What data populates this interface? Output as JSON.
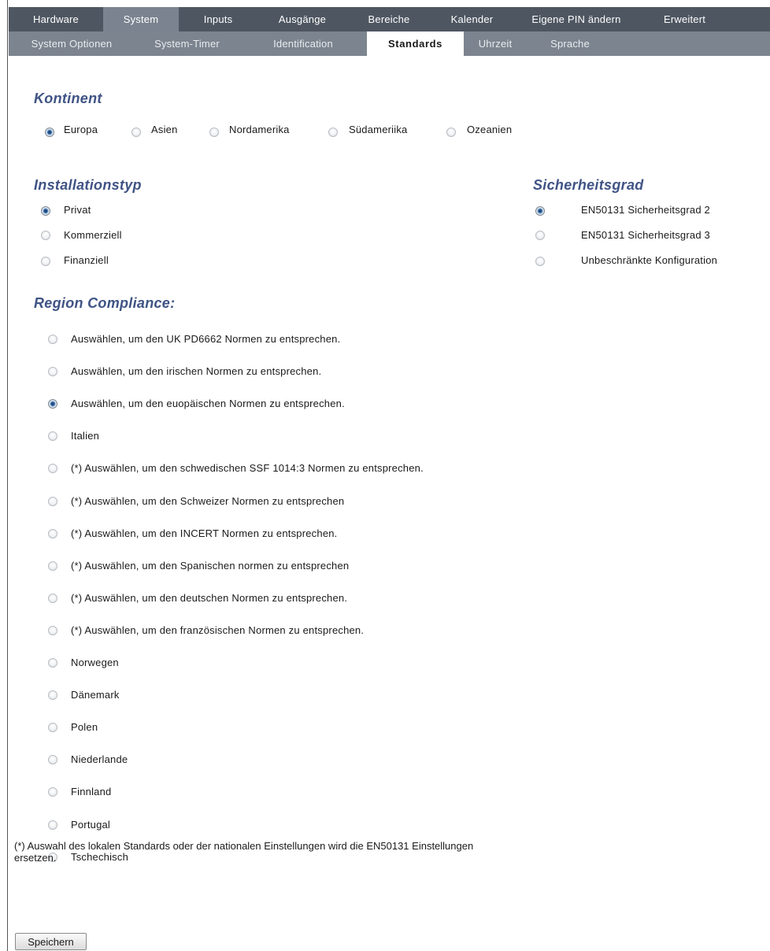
{
  "nav_primary": [
    {
      "label": "Hardware",
      "active": false
    },
    {
      "label": "System",
      "active": true
    },
    {
      "label": "Inputs",
      "active": false
    },
    {
      "label": "Ausgänge",
      "active": false
    },
    {
      "label": "Bereiche",
      "active": false
    },
    {
      "label": "Kalender",
      "active": false
    },
    {
      "label": "Eigene PIN ändern",
      "active": false
    },
    {
      "label": "Erweitert",
      "active": false
    }
  ],
  "nav_secondary": [
    {
      "label": "System Optionen",
      "active": false
    },
    {
      "label": "System-Timer",
      "active": false
    },
    {
      "label": "Identification",
      "active": false
    },
    {
      "label": "Standards",
      "active": true
    },
    {
      "label": "Uhrzeit",
      "active": false
    },
    {
      "label": "Sprache",
      "active": false
    }
  ],
  "kontinent": {
    "heading": "Kontinent",
    "selected": "Europa",
    "options": [
      "Europa",
      "Asien",
      "Nordamerika",
      "Südameriika",
      "Ozeanien"
    ]
  },
  "installationstyp": {
    "heading": "Installationstyp",
    "selected": "Privat",
    "options": [
      "Privat",
      "Kommerziell",
      "Finanziell"
    ]
  },
  "sicherheitsgrad": {
    "heading": "Sicherheitsgrad",
    "selected": "EN50131 Sicherheitsgrad 2",
    "options": [
      "EN50131 Sicherheitsgrad 2",
      "EN50131 Sicherheitsgrad 3",
      "Unbeschränkte Konfiguration"
    ]
  },
  "region": {
    "heading": "Region Compliance:",
    "selected": "Auswählen, um den euopäischen Normen zu entsprechen.",
    "options": [
      "Auswählen, um den UK PD6662 Normen zu entsprechen.",
      "Auswählen, um den irischen Normen zu entsprechen.",
      "Auswählen, um den euopäischen Normen zu entsprechen.",
      "Italien",
      "(*) Auswählen, um den schwedischen SSF 1014:3 Normen zu entsprechen.",
      "(*) Auswählen, um den Schweizer Normen zu entsprechen",
      "(*) Auswählen, um den INCERT Normen zu entsprechen.",
      "(*) Auswählen, um den Spanischen normen zu entsprechen",
      "(*) Auswählen, um den deutschen Normen zu entsprechen.",
      "(*) Auswählen, um den französischen Normen zu entsprechen.",
      "Norwegen",
      "Dänemark",
      "Polen",
      "Niederlande",
      "Finnland",
      "Portugal",
      "Tschechisch"
    ]
  },
  "footnote": "(*) Auswahl des lokalen Standards oder der nationalen Einstellungen wird die EN50131 Einstellungen ersetzen.",
  "save_label": "Speichern",
  "colors": {
    "nav_primary_bg": "#4e5661",
    "nav_secondary_bg": "#7c848f",
    "heading_color": "#3f5384",
    "radio_selected": "#2b5a92"
  }
}
